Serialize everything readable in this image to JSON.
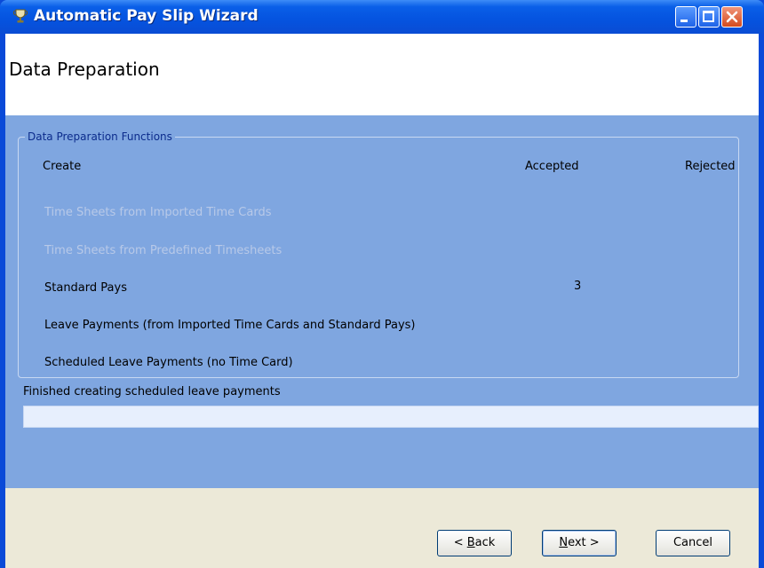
{
  "window": {
    "title": "Automatic Pay Slip Wizard",
    "icon": "trophy-icon"
  },
  "header": {
    "title": "Data Preparation"
  },
  "groupbox": {
    "label": "Data Preparation Functions",
    "columns": {
      "create": "Create",
      "accepted": "Accepted",
      "rejected": "Rejected"
    },
    "rows": [
      {
        "label": "Time Sheets from Imported Time Cards",
        "enabled": false,
        "accepted": ""
      },
      {
        "label": "Time Sheets from Predefined Timesheets",
        "enabled": false,
        "accepted": ""
      },
      {
        "label": "Standard Pays",
        "enabled": true,
        "accepted": "3"
      },
      {
        "label": "Leave Payments (from Imported Time Cards and Standard Pays)",
        "enabled": true,
        "accepted": ""
      },
      {
        "label": "Scheduled Leave Payments (no Time Card)",
        "enabled": true,
        "accepted": ""
      }
    ]
  },
  "status": {
    "text": "Finished creating scheduled leave payments"
  },
  "buttons": {
    "back": {
      "mnemonic": "B",
      "rest": "ack",
      "prefix": "< "
    },
    "next": {
      "mnemonic": "N",
      "rest": "ext",
      "suffix": " >"
    },
    "cancel": "Cancel"
  },
  "colors": {
    "titlebar": "#0554e0",
    "panel": "#7fa6e0",
    "button_area": "#ece9d8"
  }
}
